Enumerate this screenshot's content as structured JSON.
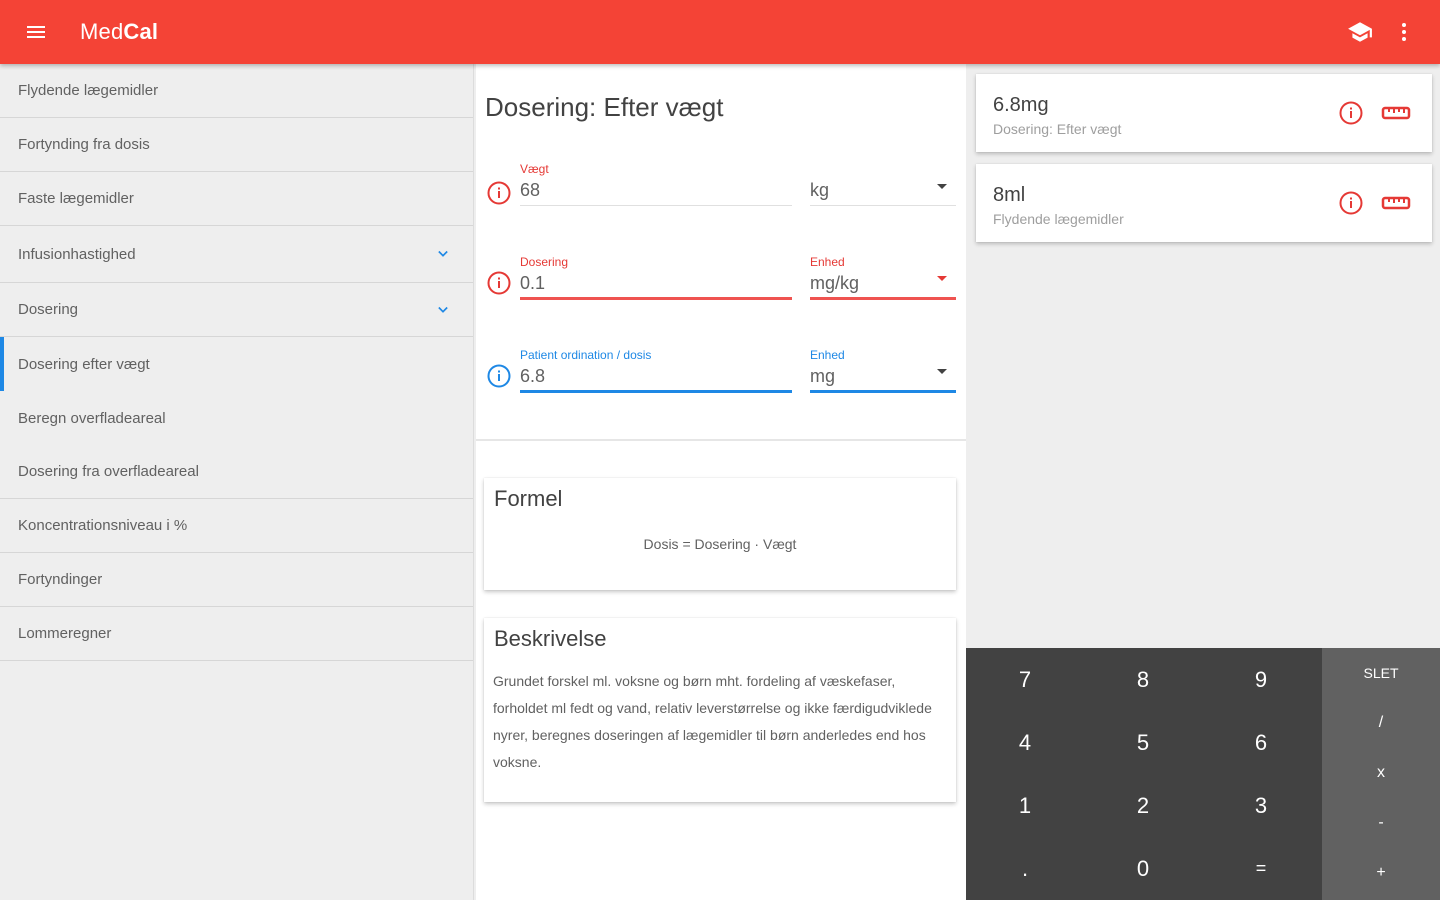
{
  "appbar": {
    "title_light": "Med",
    "title_bold": "Cal",
    "icons": [
      "menu-icon",
      "school-icon",
      "more-vert-icon"
    ]
  },
  "sidebar": {
    "items": [
      {
        "label": "Flydende lægemidler"
      },
      {
        "label": "Fortynding fra dosis"
      },
      {
        "label": "Faste lægemidler"
      },
      {
        "label": "Infusionhastighed",
        "expandable": true
      },
      {
        "label": "Dosering",
        "expandable": true
      },
      {
        "label": "Dosering efter vægt",
        "active": true
      },
      {
        "label": "Beregn overfladeareal"
      },
      {
        "label": "Dosering fra overfladeareal"
      },
      {
        "label": "Koncentrationsniveau i %"
      },
      {
        "label": "Fortyndinger"
      },
      {
        "label": "Lommeregner"
      }
    ]
  },
  "calculator": {
    "title": "Dosering: Efter vægt",
    "fields": {
      "weight": {
        "label": "Vægt",
        "value": "68",
        "unit": "kg",
        "unit_label": ""
      },
      "dosage": {
        "label": "Dosering",
        "value": "0.1",
        "unit": "mg/kg",
        "unit_label": "Enhed"
      },
      "result": {
        "label": "Patient ordination / dosis",
        "value": "6.8",
        "unit": "mg",
        "unit_label": "Enhed"
      }
    },
    "formula": {
      "title": "Formel",
      "expression": "Dosis  =  Dosering  ·  Vægt"
    },
    "description": {
      "title": "Beskrivelse",
      "text": "Grundet forskel ml. voksne og børn mht. fordeling af væskefaser, forholdet ml fedt og vand, relativ leverstørrelse og ikke færdigudviklede nyrer, beregnes doseringen af lægemidler til børn anderledes end hos voksne."
    }
  },
  "results": [
    {
      "value": "6.8mg",
      "subtitle": "Dosering: Efter vægt"
    },
    {
      "value": "8ml",
      "subtitle": "Flydende lægemidler"
    }
  ],
  "keypad": {
    "digits": [
      "7",
      "8",
      "9",
      "4",
      "5",
      "6",
      "1",
      "2",
      "3",
      ".",
      "0",
      "="
    ],
    "ops": [
      "SLET",
      "/",
      "x",
      "-",
      "+"
    ]
  },
  "colors": {
    "primary": "#f44336",
    "accent_blue": "#1e88e5",
    "keypad": "#424242",
    "keypad_ops": "#616161"
  }
}
